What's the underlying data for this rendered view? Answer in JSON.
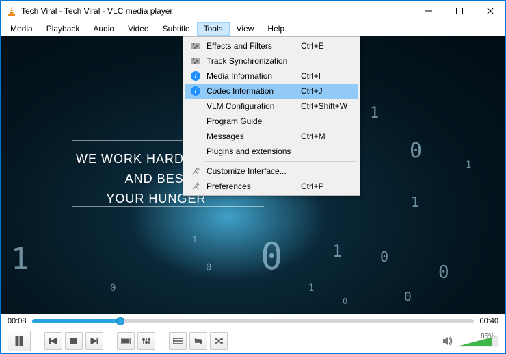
{
  "title": "Tech Viral - Tech Viral - VLC media player",
  "menubar": [
    "Media",
    "Playback",
    "Audio",
    "Video",
    "Subtitle",
    "Tools",
    "View",
    "Help"
  ],
  "menubar_active": "Tools",
  "dropdown": {
    "items": [
      {
        "icon": "slider",
        "label": "Effects and Filters",
        "shortcut": "Ctrl+E"
      },
      {
        "icon": "slider",
        "label": "Track Synchronization",
        "shortcut": ""
      },
      {
        "icon": "info",
        "label": "Media Information",
        "shortcut": "Ctrl+I"
      },
      {
        "icon": "info",
        "label": "Codec Information",
        "shortcut": "Ctrl+J",
        "highlight": true
      },
      {
        "icon": "",
        "label": "VLM Configuration",
        "shortcut": "Ctrl+Shift+W"
      },
      {
        "icon": "",
        "label": "Program Guide",
        "shortcut": ""
      },
      {
        "icon": "",
        "label": "Messages",
        "shortcut": "Ctrl+M"
      },
      {
        "icon": "",
        "label": "Plugins and extensions",
        "shortcut": ""
      },
      {
        "sep": true
      },
      {
        "icon": "tools",
        "label": "Customize Interface...",
        "shortcut": ""
      },
      {
        "icon": "tools",
        "label": "Preferences",
        "shortcut": "Ctrl+P"
      }
    ]
  },
  "video_text": {
    "line1": "WE WORK HARD TO",
    "line2": "AND BEST O",
    "line3": "YOUR HUNGER"
  },
  "time": {
    "current": "00:08",
    "total": "00:40",
    "progress_pct": 20
  },
  "volume": {
    "pct_label": "85%",
    "fill_pct": 85
  }
}
